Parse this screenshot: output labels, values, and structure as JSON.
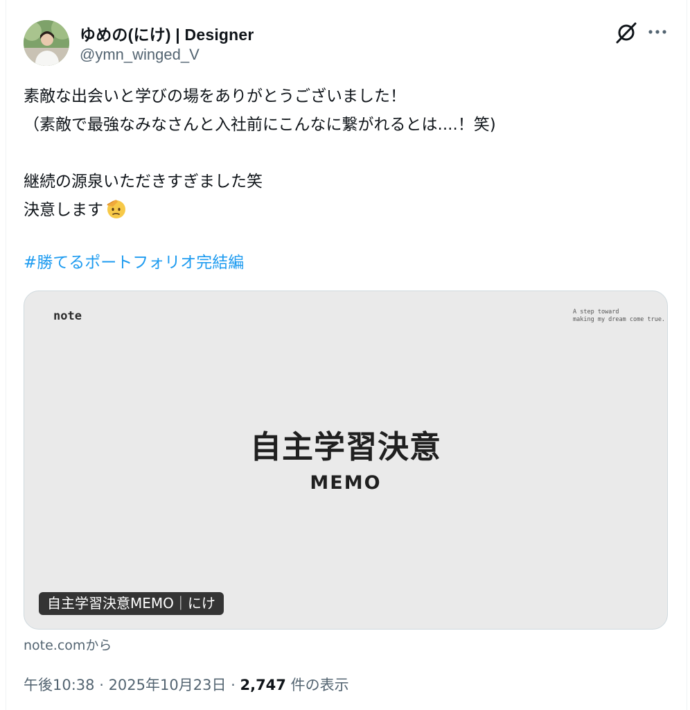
{
  "author": {
    "display_name": "ゆめの(にけ) | Designer",
    "handle": "@ymn_winged_V"
  },
  "icons": {
    "avatar": "avatar",
    "grok": "grok-icon",
    "more": "more-icon",
    "emoji": "saluting-face-emoji"
  },
  "tweet": {
    "lines": [
      "素敵な出会いと学びの場をありがとうございました！",
      "（素敵で最強なみなさんと入社前にこんなに繋がれるとは....！笑)",
      "",
      "継続の源泉いただきすぎました笑",
      "決意します"
    ],
    "hashtag": "#勝てるポートフォリオ完結編"
  },
  "link_card": {
    "logo": "note",
    "tagline": "A step toward\nmaking my dream come true.",
    "hero_title": "自主学習決意",
    "hero_subtitle": "MEMO",
    "label": "自主学習決意MEMO｜にけ",
    "source": "note.comから"
  },
  "meta": {
    "time": "午後10:38",
    "separator": " · ",
    "date": "2025年10月23日",
    "views_count": "2,747",
    "views_label": " 件の表示"
  },
  "colors": {
    "link": "#1d9bf0",
    "secondary_text": "#536471",
    "card_bg": "#eaeaea"
  }
}
